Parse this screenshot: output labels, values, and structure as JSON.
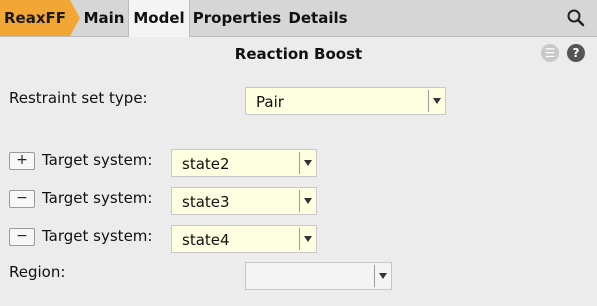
{
  "tabs": {
    "breadcrumb": "ReaxFF",
    "items": [
      {
        "label": "Main"
      },
      {
        "label": "Model"
      },
      {
        "label": "Properties"
      },
      {
        "label": "Details"
      }
    ],
    "active": "Model"
  },
  "header": {
    "title": "Reaction Boost",
    "menu_symbol": "☰",
    "help_symbol": "?"
  },
  "form": {
    "restraint_label": "Restraint set type:",
    "restraint_value": "Pair",
    "targets": [
      {
        "button": "+",
        "label": "Target system:",
        "value": "state2"
      },
      {
        "button": "−",
        "label": "Target system:",
        "value": "state3"
      },
      {
        "button": "−",
        "label": "Target system:",
        "value": "state4"
      }
    ],
    "region_label": "Region:",
    "region_value": ""
  },
  "colors": {
    "breadcrumb": "#f2a633",
    "combo_bg": "#fefee0",
    "background": "#ececec"
  }
}
